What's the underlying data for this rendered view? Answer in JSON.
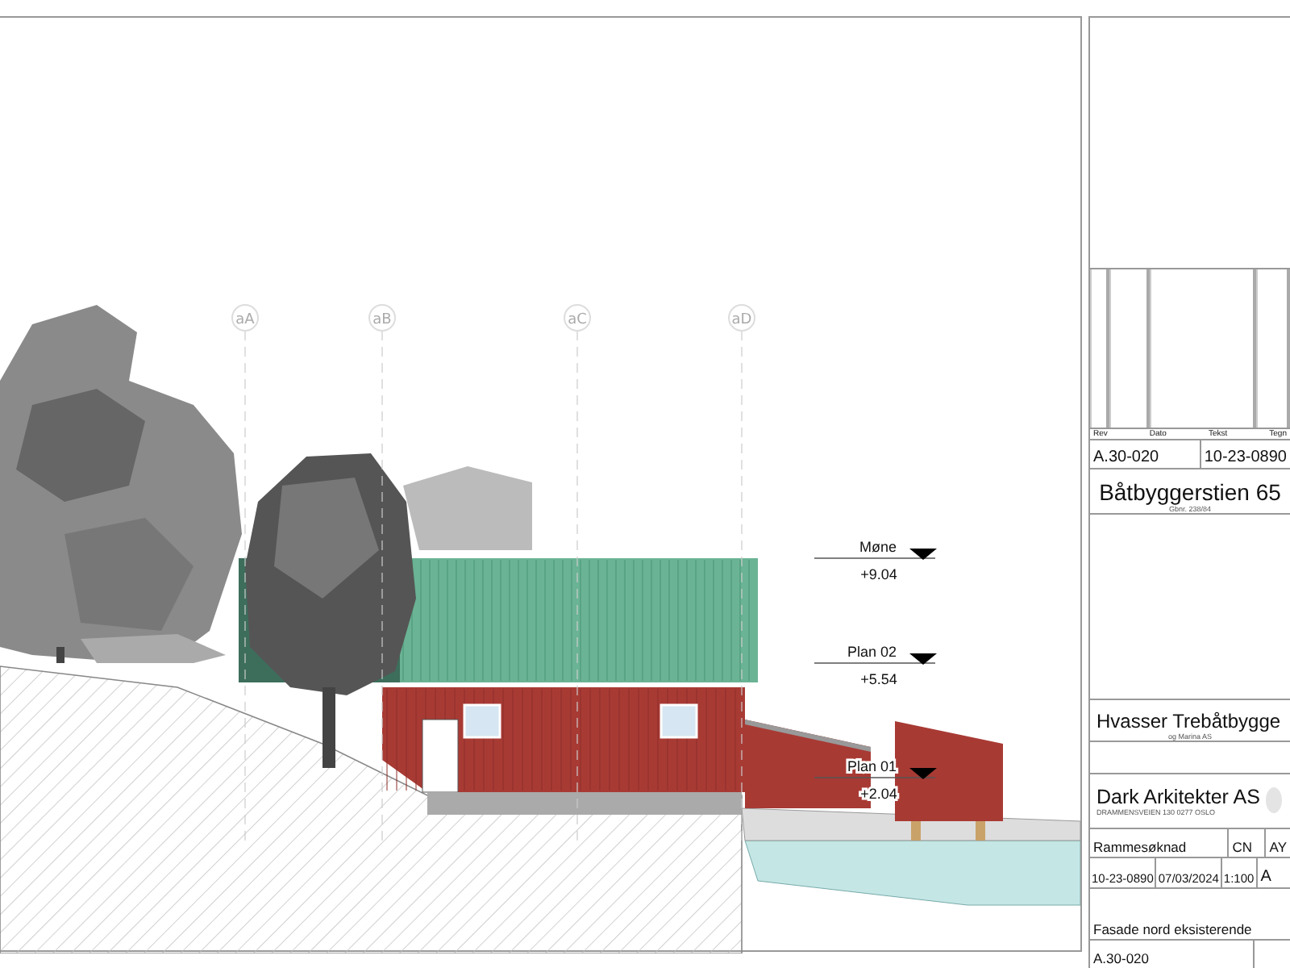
{
  "grid_lines": [
    {
      "label": "aA"
    },
    {
      "label": "aB"
    },
    {
      "label": "aC"
    },
    {
      "label": "aD"
    }
  ],
  "levels": [
    {
      "name": "Møne",
      "elevation": "+9.04"
    },
    {
      "name": "Plan 02",
      "elevation": "+5.54"
    },
    {
      "name": "Plan 01",
      "elevation": "+2.04"
    }
  ],
  "title_block": {
    "revision_headers": [
      "Rev",
      "Dato",
      "Tekst",
      "Tegn"
    ],
    "drawing_number_top": "A.30-020",
    "project_number_top": "10-23-0890",
    "project_name": "Båtbyggerstien 65",
    "property_id": "Gbnr. 238/84",
    "client": "Hvasser Trebåtbygge",
    "client_sub": "og Marina AS",
    "architect": "Dark Arkitekter AS",
    "architect_address": "DRAMMENSVEIEN 130   0277 OSLO",
    "type": "Rammesøknad",
    "drawn_by": "CN",
    "checked_by": "AY",
    "project_number": "10-23-0890",
    "date": "07/03/2024",
    "scale": "1:100",
    "sheet_size": "A",
    "title": "Fasade nord eksisterende",
    "drawing_number": "A.30-020"
  }
}
